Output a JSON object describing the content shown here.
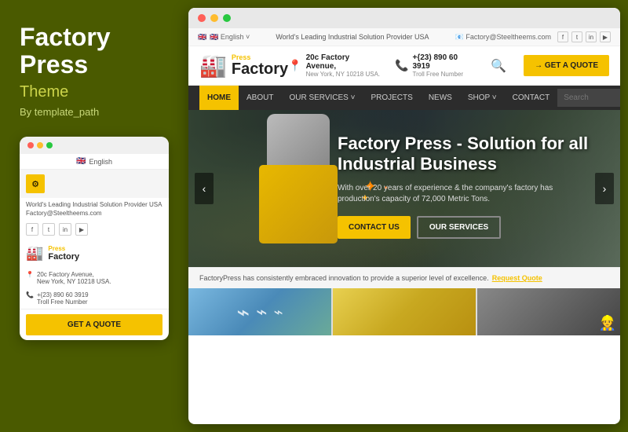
{
  "left": {
    "title_line1": "Factory",
    "title_line2": "Press",
    "subtitle": "Theme",
    "author": "By template_path"
  },
  "mobile": {
    "language": "English",
    "tagline": "World's Leading Industrial Solution Provider USA",
    "email": "Factory@Steeltheems.com",
    "socials": [
      "f",
      "t",
      "in",
      "▶"
    ],
    "logo_press": "Press",
    "logo_factory": "Factory",
    "address_line1": "20c Factory Avenue,",
    "address_line2": "New York, NY 10218 USA.",
    "phone": "+{23) 890 60 3919",
    "phone_sub": "Troll Free Number",
    "cta": "GET A QUOTE"
  },
  "browser": {
    "topbar": {
      "language": "🇬🇧 English ˅",
      "tagline": "World's Leading Industrial Solution Provider USA",
      "email": "📧 Factory@Steeltheems.com",
      "socials": [
        "f",
        "t",
        "in",
        "▶"
      ]
    },
    "header": {
      "logo_press": "Press",
      "logo_factory": "Factory",
      "address_line1": "20c Factory Avenue,",
      "address_line2": "New York, NY 10218 USA.",
      "phone": "+{23) 890 60 3919",
      "phone_sub": "Troll Free Number",
      "get_quote": "→ GET A QUOTE"
    },
    "nav": {
      "items": [
        {
          "label": "HOME",
          "active": true
        },
        {
          "label": "ABOUT",
          "active": false
        },
        {
          "label": "OUR SERVICES ˅",
          "active": false
        },
        {
          "label": "PROJECTS",
          "active": false
        },
        {
          "label": "NEWS",
          "active": false
        },
        {
          "label": "SHOP ˅",
          "active": false
        },
        {
          "label": "CONTACT",
          "active": false
        }
      ],
      "search_placeholder": "Search"
    },
    "hero": {
      "title": "Factory Press - Solution for all Industrial Business",
      "text": "With over 20 years of experience & the company's factory has production's capacity of 72,000 Metric Tons.",
      "btn_contact": "CONTACT US",
      "btn_services": "OUR SERVICES"
    },
    "info_banner": {
      "text": "FactoryPress has consistently embraced innovation to provide a superior level of excellence.",
      "link": "Request Quote"
    }
  }
}
